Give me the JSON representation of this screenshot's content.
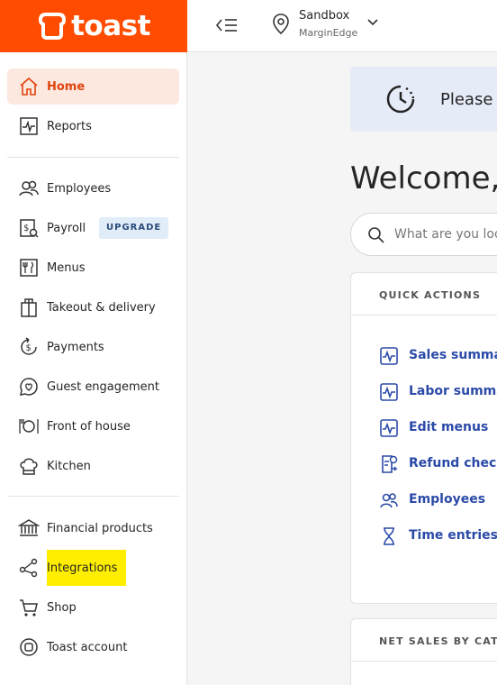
{
  "brand": {
    "logo_text": "toast",
    "accent": "#ff4c00"
  },
  "header": {
    "location_name": "Sandbox",
    "location_sub": "MarginEdge"
  },
  "sidebar": {
    "items": [
      {
        "label": "Home",
        "icon": "home-icon",
        "active": true
      },
      {
        "label": "Reports",
        "icon": "reports-icon"
      },
      {
        "label": "Employees",
        "icon": "employees-icon"
      },
      {
        "label": "Payroll",
        "icon": "payroll-icon",
        "badge": "UPGRADE"
      },
      {
        "label": "Menus",
        "icon": "menus-icon"
      },
      {
        "label": "Takeout & delivery",
        "icon": "takeout-icon"
      },
      {
        "label": "Payments",
        "icon": "payments-icon"
      },
      {
        "label": "Guest engagement",
        "icon": "guest-engagement-icon"
      },
      {
        "label": "Front of house",
        "icon": "front-of-house-icon"
      },
      {
        "label": "Kitchen",
        "icon": "kitchen-icon"
      },
      {
        "label": "Financial products",
        "icon": "bank-icon"
      },
      {
        "label": "Integrations",
        "icon": "integrations-icon",
        "highlighted": true
      },
      {
        "label": "Shop",
        "icon": "cart-icon"
      },
      {
        "label": "Toast account",
        "icon": "account-icon"
      }
    ]
  },
  "main": {
    "banner_text": "Please f",
    "welcome": "Welcome,",
    "search_placeholder": "What are you loo",
    "quick_actions": {
      "title": "QUICK ACTIONS",
      "items": [
        {
          "label": "Sales summar",
          "icon": "chart-icon"
        },
        {
          "label": "Labor summar",
          "icon": "chart-icon"
        },
        {
          "label": "Edit menus",
          "icon": "chart-icon"
        },
        {
          "label": "Refund check",
          "icon": "refund-icon"
        },
        {
          "label": "Employees",
          "icon": "employees-icon"
        },
        {
          "label": "Time entries",
          "icon": "hourglass-icon"
        }
      ]
    },
    "net_sales_title": "NET SALES BY CATEGO"
  }
}
